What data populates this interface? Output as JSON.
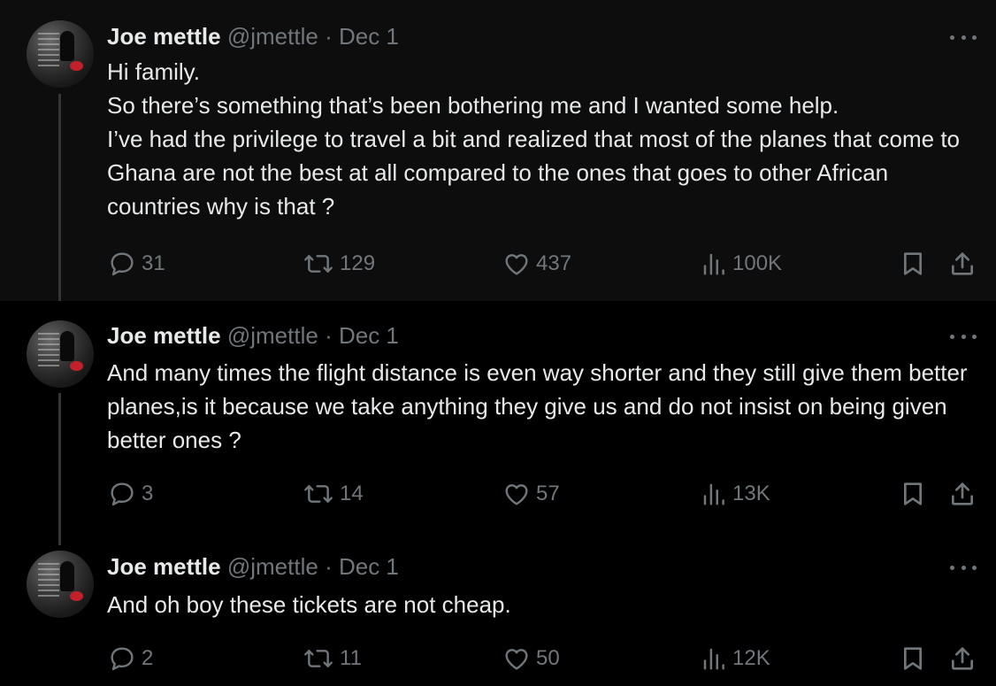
{
  "tweets": [
    {
      "name": "Joe mettle",
      "handle": "@jmettle",
      "separator": "·",
      "date": "Dec 1",
      "lines": [
        "Hi family.",
        "So there’s something that’s been bothering me and I wanted some help.",
        "I’ve had the privilege to travel a bit and realized that most of the planes that come to Ghana are not the best at all compared to the ones that goes to other African countries why is that ?"
      ],
      "replies": "31",
      "reposts": "129",
      "likes": "437",
      "views": "100K"
    },
    {
      "name": "Joe mettle",
      "handle": "@jmettle",
      "separator": "·",
      "date": "Dec 1",
      "lines": [
        "And many times the flight distance is even way shorter and they still give them better planes,is it because we take anything they give us and do not insist on being given better ones ?"
      ],
      "replies": "3",
      "reposts": "14",
      "likes": "57",
      "views": "13K"
    },
    {
      "name": "Joe mettle",
      "handle": "@jmettle",
      "separator": "·",
      "date": "Dec 1",
      "lines": [
        "And oh boy these tickets are not cheap."
      ],
      "replies": "2",
      "reposts": "11",
      "likes": "50",
      "views": "12K"
    }
  ],
  "icons": {
    "reply": "speech-bubble-icon",
    "repost": "repost-arrows-icon",
    "like": "heart-icon",
    "views": "bar-chart-icon",
    "bookmark": "bookmark-icon",
    "share": "share-upload-icon",
    "more": "more-dots-icon"
  },
  "colors": {
    "background": "#000000",
    "highlight_background": "#0d0d0d",
    "text": "#e7e9ea",
    "muted": "#71767b",
    "thread_line": "#333639"
  }
}
